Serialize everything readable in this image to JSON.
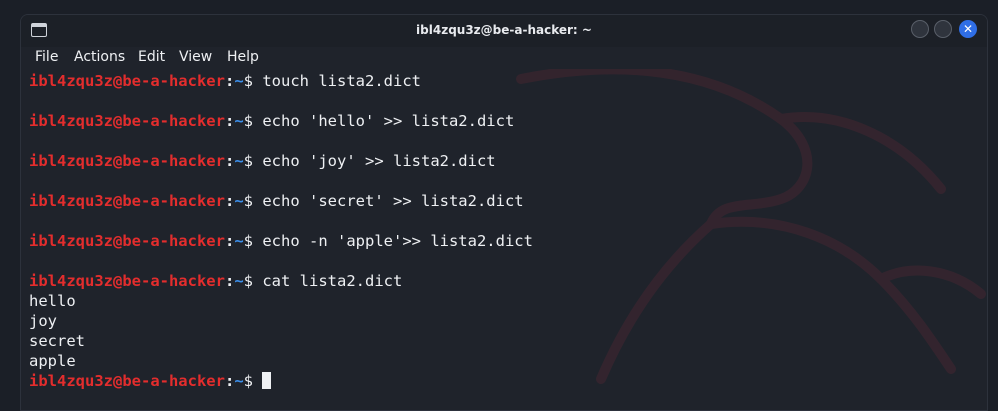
{
  "window": {
    "title": "ibl4zqu3z@be-a-hacker: ~",
    "close_glyph": "✕"
  },
  "menu": [
    "File",
    "Actions",
    "Edit",
    "View",
    "Help"
  ],
  "prompt": {
    "user_host": "ibl4zqu3z@be-a-hacker",
    "colon": ":",
    "path": "~",
    "symbol": "$"
  },
  "terminal_lines": [
    {
      "type": "prompt",
      "command": "touch lista2.dict"
    },
    {
      "type": "blank"
    },
    {
      "type": "prompt",
      "command": "echo 'hello' >> lista2.dict"
    },
    {
      "type": "blank"
    },
    {
      "type": "prompt",
      "command": "echo 'joy' >> lista2.dict"
    },
    {
      "type": "blank"
    },
    {
      "type": "prompt",
      "command": "echo 'secret' >> lista2.dict"
    },
    {
      "type": "blank"
    },
    {
      "type": "prompt",
      "command": "echo -n 'apple'>> lista2.dict"
    },
    {
      "type": "blank"
    },
    {
      "type": "prompt",
      "command": "cat lista2.dict"
    },
    {
      "type": "output",
      "text": "hello"
    },
    {
      "type": "output",
      "text": "joy"
    },
    {
      "type": "output",
      "text": "secret"
    },
    {
      "type": "output",
      "text": "apple"
    },
    {
      "type": "prompt",
      "command": "",
      "cursor": true
    }
  ],
  "colors": {
    "prompt_user": "#e32d2d",
    "prompt_path": "#3b8eea",
    "text": "#eef0f3",
    "background": "#1f232b",
    "close_button": "#2f6ee6"
  },
  "icons": [
    "terminal-app-icon",
    "minimize-icon",
    "maximize-icon",
    "close-icon",
    "kali-dragon-watermark"
  ]
}
